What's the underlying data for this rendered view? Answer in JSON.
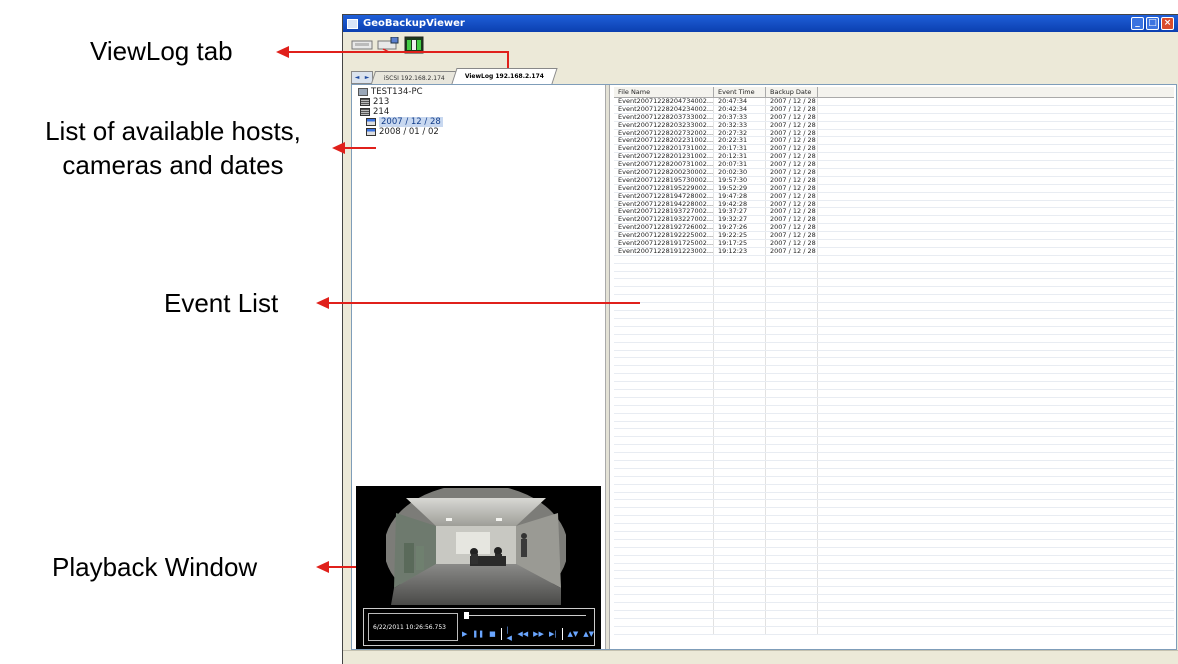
{
  "annotations": {
    "viewlog_tab": "ViewLog tab",
    "host_list_line1": "List of available hosts,",
    "host_list_line2": "cameras and dates",
    "event_list": "Event List",
    "playback_window": "Playback Window"
  },
  "colors": {
    "arrow": "#e0201b",
    "titlebar": "#0b3fb0",
    "window_bg": "#ece9d8"
  },
  "window": {
    "title": "GeoBackupViewer",
    "buttons": [
      "_",
      "□",
      "×"
    ]
  },
  "toolbar": {
    "icons": [
      "connect-icon",
      "disconnect-icon",
      "viewlog-icon"
    ]
  },
  "tabs": {
    "nav": [
      "◄",
      "►"
    ],
    "items": [
      {
        "label": "iSCSI 192.168.2.174",
        "active": false
      },
      {
        "label": "ViewLog 192.168.2.174",
        "active": true
      }
    ]
  },
  "tree": {
    "root": "TEST134-PC",
    "cameras": [
      "213",
      "214"
    ],
    "dates": [
      "2007 / 12 / 28",
      "2008 / 01 / 02"
    ]
  },
  "player": {
    "timestamp": "6/22/2011 10:26:56.753",
    "buttons": [
      "▶",
      "❚❚",
      "■",
      "|◀",
      "◀◀",
      "▶▶",
      "▶|",
      "▲▼",
      "▲▼"
    ]
  },
  "events": {
    "columns": [
      "File Name",
      "Event Time",
      "Backup Date"
    ],
    "rows": [
      [
        "Event20071228204734002...",
        "20:47:34",
        "2007 / 12 / 28"
      ],
      [
        "Event20071228204234002...",
        "20:42:34",
        "2007 / 12 / 28"
      ],
      [
        "Event20071228203733002...",
        "20:37:33",
        "2007 / 12 / 28"
      ],
      [
        "Event20071228203233002...",
        "20:32:33",
        "2007 / 12 / 28"
      ],
      [
        "Event20071228202732002...",
        "20:27:32",
        "2007 / 12 / 28"
      ],
      [
        "Event20071228202231002...",
        "20:22:31",
        "2007 / 12 / 28"
      ],
      [
        "Event20071228201731002...",
        "20:17:31",
        "2007 / 12 / 28"
      ],
      [
        "Event20071228201231002...",
        "20:12:31",
        "2007 / 12 / 28"
      ],
      [
        "Event20071228200731002...",
        "20:07:31",
        "2007 / 12 / 28"
      ],
      [
        "Event20071228200230002...",
        "20:02:30",
        "2007 / 12 / 28"
      ],
      [
        "Event20071228195730002...",
        "19:57:30",
        "2007 / 12 / 28"
      ],
      [
        "Event20071228195229002...",
        "19:52:29",
        "2007 / 12 / 28"
      ],
      [
        "Event20071228194728002...",
        "19:47:28",
        "2007 / 12 / 28"
      ],
      [
        "Event20071228194228002...",
        "19:42:28",
        "2007 / 12 / 28"
      ],
      [
        "Event20071228193727002...",
        "19:37:27",
        "2007 / 12 / 28"
      ],
      [
        "Event20071228193227002...",
        "19:32:27",
        "2007 / 12 / 28"
      ],
      [
        "Event20071228192726002...",
        "19:27:26",
        "2007 / 12 / 28"
      ],
      [
        "Event20071228192225002...",
        "19:22:25",
        "2007 / 12 / 28"
      ],
      [
        "Event20071228191725002...",
        "19:17:25",
        "2007 / 12 / 28"
      ],
      [
        "Event20071228191223002...",
        "19:12:23",
        "2007 / 12 / 28"
      ]
    ]
  }
}
